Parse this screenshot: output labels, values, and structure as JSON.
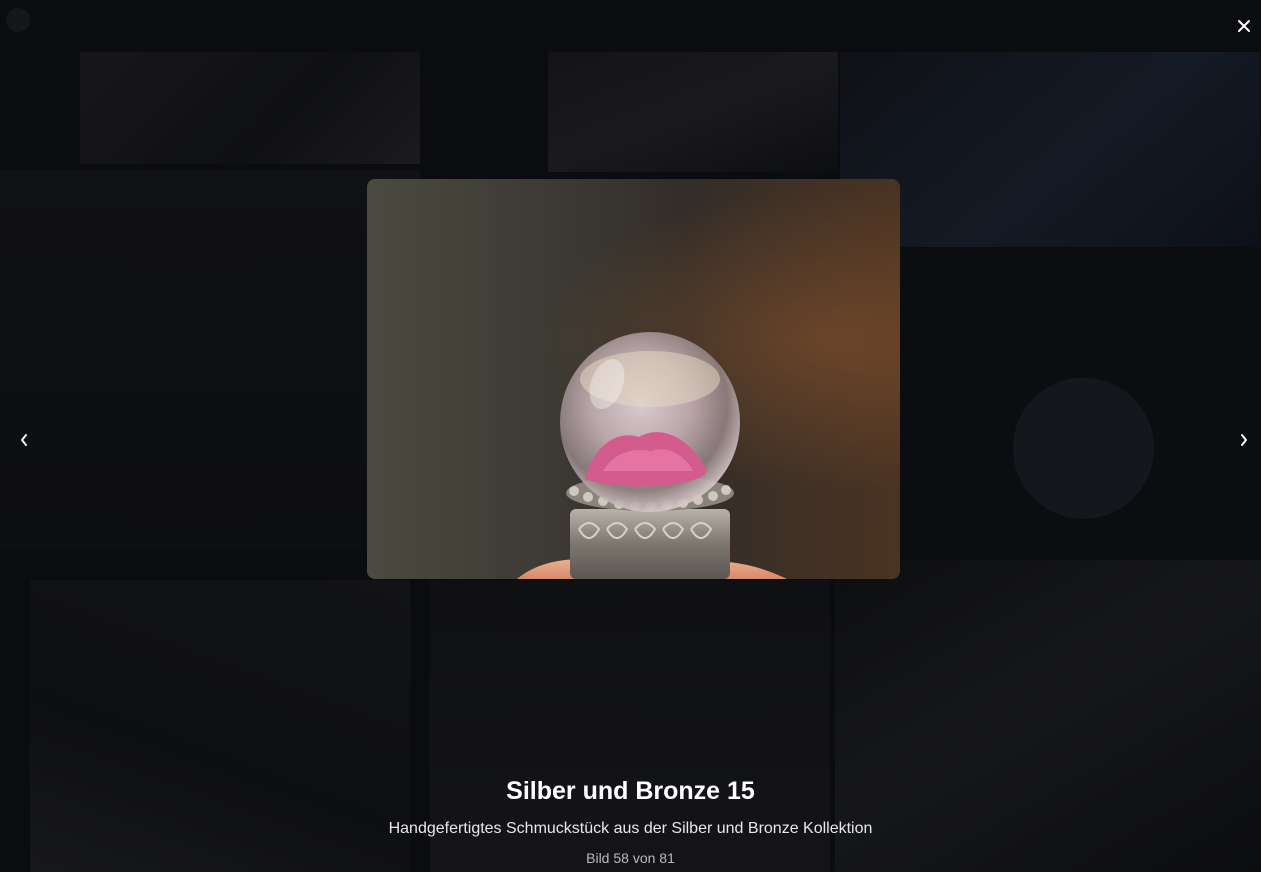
{
  "lightbox": {
    "title": "Silber und Bronze 15",
    "description": "Handgefertigtes Schmuckstück aus der Silber und Bronze Kollektion",
    "counter": "Bild 58 von 81",
    "image_alt": "Silber und Bronze 15"
  },
  "controls": {
    "close_icon": "close-icon",
    "prev_icon": "chevron-left-icon",
    "next_icon": "chevron-right-icon"
  },
  "colors": {
    "overlay": "#07080b",
    "title": "#ffffff",
    "description": "#e8e8ea",
    "counter": "#b9bac0"
  }
}
